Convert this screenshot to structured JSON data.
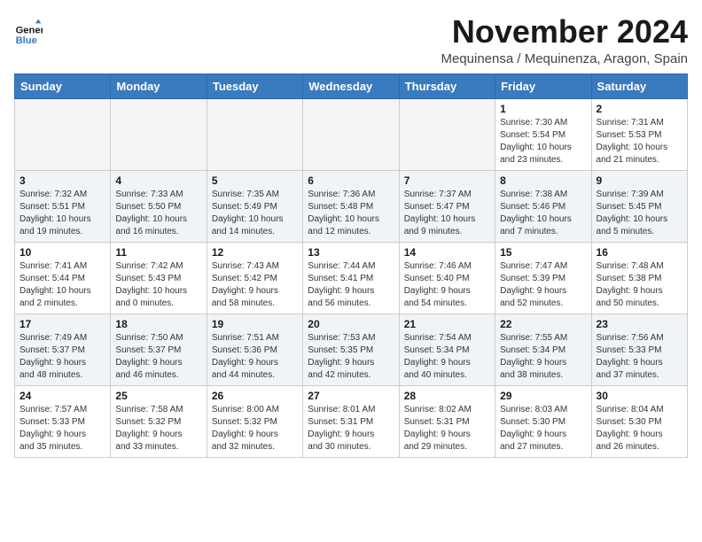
{
  "logo": {
    "line1": "General",
    "line2": "Blue"
  },
  "title": "November 2024",
  "location": "Mequinensa / Mequinenza, Aragon, Spain",
  "days_of_week": [
    "Sunday",
    "Monday",
    "Tuesday",
    "Wednesday",
    "Thursday",
    "Friday",
    "Saturday"
  ],
  "weeks": [
    [
      {
        "day": "",
        "info": ""
      },
      {
        "day": "",
        "info": ""
      },
      {
        "day": "",
        "info": ""
      },
      {
        "day": "",
        "info": ""
      },
      {
        "day": "",
        "info": ""
      },
      {
        "day": "1",
        "info": "Sunrise: 7:30 AM\nSunset: 5:54 PM\nDaylight: 10 hours\nand 23 minutes."
      },
      {
        "day": "2",
        "info": "Sunrise: 7:31 AM\nSunset: 5:53 PM\nDaylight: 10 hours\nand 21 minutes."
      }
    ],
    [
      {
        "day": "3",
        "info": "Sunrise: 7:32 AM\nSunset: 5:51 PM\nDaylight: 10 hours\nand 19 minutes."
      },
      {
        "day": "4",
        "info": "Sunrise: 7:33 AM\nSunset: 5:50 PM\nDaylight: 10 hours\nand 16 minutes."
      },
      {
        "day": "5",
        "info": "Sunrise: 7:35 AM\nSunset: 5:49 PM\nDaylight: 10 hours\nand 14 minutes."
      },
      {
        "day": "6",
        "info": "Sunrise: 7:36 AM\nSunset: 5:48 PM\nDaylight: 10 hours\nand 12 minutes."
      },
      {
        "day": "7",
        "info": "Sunrise: 7:37 AM\nSunset: 5:47 PM\nDaylight: 10 hours\nand 9 minutes."
      },
      {
        "day": "8",
        "info": "Sunrise: 7:38 AM\nSunset: 5:46 PM\nDaylight: 10 hours\nand 7 minutes."
      },
      {
        "day": "9",
        "info": "Sunrise: 7:39 AM\nSunset: 5:45 PM\nDaylight: 10 hours\nand 5 minutes."
      }
    ],
    [
      {
        "day": "10",
        "info": "Sunrise: 7:41 AM\nSunset: 5:44 PM\nDaylight: 10 hours\nand 2 minutes."
      },
      {
        "day": "11",
        "info": "Sunrise: 7:42 AM\nSunset: 5:43 PM\nDaylight: 10 hours\nand 0 minutes."
      },
      {
        "day": "12",
        "info": "Sunrise: 7:43 AM\nSunset: 5:42 PM\nDaylight: 9 hours\nand 58 minutes."
      },
      {
        "day": "13",
        "info": "Sunrise: 7:44 AM\nSunset: 5:41 PM\nDaylight: 9 hours\nand 56 minutes."
      },
      {
        "day": "14",
        "info": "Sunrise: 7:46 AM\nSunset: 5:40 PM\nDaylight: 9 hours\nand 54 minutes."
      },
      {
        "day": "15",
        "info": "Sunrise: 7:47 AM\nSunset: 5:39 PM\nDaylight: 9 hours\nand 52 minutes."
      },
      {
        "day": "16",
        "info": "Sunrise: 7:48 AM\nSunset: 5:38 PM\nDaylight: 9 hours\nand 50 minutes."
      }
    ],
    [
      {
        "day": "17",
        "info": "Sunrise: 7:49 AM\nSunset: 5:37 PM\nDaylight: 9 hours\nand 48 minutes."
      },
      {
        "day": "18",
        "info": "Sunrise: 7:50 AM\nSunset: 5:37 PM\nDaylight: 9 hours\nand 46 minutes."
      },
      {
        "day": "19",
        "info": "Sunrise: 7:51 AM\nSunset: 5:36 PM\nDaylight: 9 hours\nand 44 minutes."
      },
      {
        "day": "20",
        "info": "Sunrise: 7:53 AM\nSunset: 5:35 PM\nDaylight: 9 hours\nand 42 minutes."
      },
      {
        "day": "21",
        "info": "Sunrise: 7:54 AM\nSunset: 5:34 PM\nDaylight: 9 hours\nand 40 minutes."
      },
      {
        "day": "22",
        "info": "Sunrise: 7:55 AM\nSunset: 5:34 PM\nDaylight: 9 hours\nand 38 minutes."
      },
      {
        "day": "23",
        "info": "Sunrise: 7:56 AM\nSunset: 5:33 PM\nDaylight: 9 hours\nand 37 minutes."
      }
    ],
    [
      {
        "day": "24",
        "info": "Sunrise: 7:57 AM\nSunset: 5:33 PM\nDaylight: 9 hours\nand 35 minutes."
      },
      {
        "day": "25",
        "info": "Sunrise: 7:58 AM\nSunset: 5:32 PM\nDaylight: 9 hours\nand 33 minutes."
      },
      {
        "day": "26",
        "info": "Sunrise: 8:00 AM\nSunset: 5:32 PM\nDaylight: 9 hours\nand 32 minutes."
      },
      {
        "day": "27",
        "info": "Sunrise: 8:01 AM\nSunset: 5:31 PM\nDaylight: 9 hours\nand 30 minutes."
      },
      {
        "day": "28",
        "info": "Sunrise: 8:02 AM\nSunset: 5:31 PM\nDaylight: 9 hours\nand 29 minutes."
      },
      {
        "day": "29",
        "info": "Sunrise: 8:03 AM\nSunset: 5:30 PM\nDaylight: 9 hours\nand 27 minutes."
      },
      {
        "day": "30",
        "info": "Sunrise: 8:04 AM\nSunset: 5:30 PM\nDaylight: 9 hours\nand 26 minutes."
      }
    ]
  ]
}
